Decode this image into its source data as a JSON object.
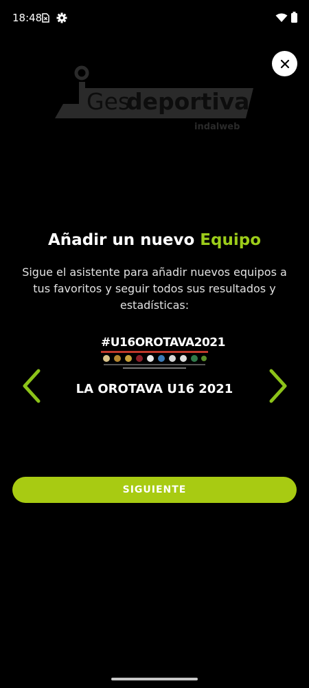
{
  "status_bar": {
    "time": "18:48",
    "icons": [
      "sim-icon",
      "gear-icon",
      "wifi-icon",
      "battery-icon"
    ]
  },
  "logo": {
    "brand_light": "Ges",
    "brand_bold": "deportiva",
    "tagline": "indalweb"
  },
  "header": {
    "title_prefix": "Añadir un nuevo ",
    "title_accent": "Equipo",
    "description": "Sigue el asistente para añadir nuevos equipos a tus favoritos y seguir todos sus resultados y estadísticas:"
  },
  "team": {
    "banner_hashtag": "#U16OROTAVA2021",
    "name": "LA OROTAVA U16 2021"
  },
  "actions": {
    "next_label": "SIGUIENTE"
  },
  "colors": {
    "accent": "#9ccc1a",
    "button": "#a8cb12",
    "background": "#000000"
  }
}
